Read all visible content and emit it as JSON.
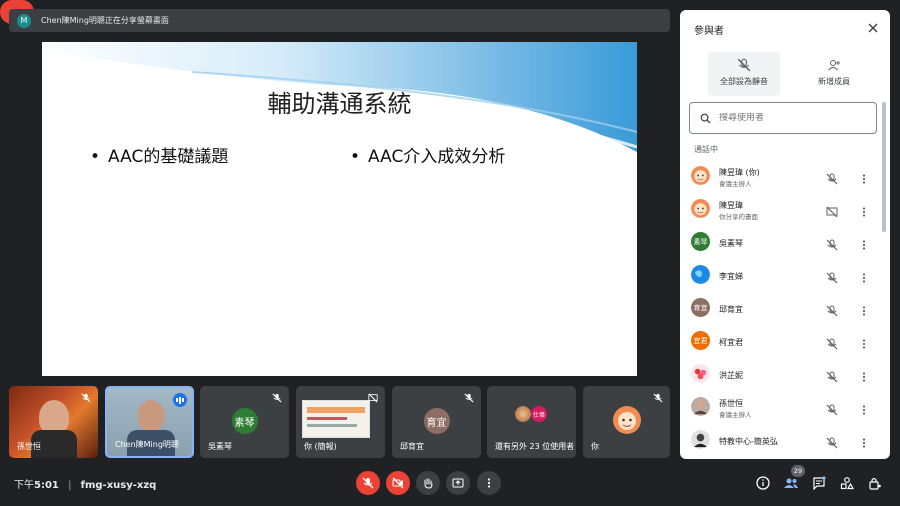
{
  "banner": {
    "avatar_letter": "M",
    "text": "Chen陳Ming明聰正在分享螢幕畫面"
  },
  "slide": {
    "title": "輔助溝通系統",
    "bullet_1": "AAC的基礎議題",
    "bullet_2": "AAC介入成效分析"
  },
  "tiles": [
    {
      "name": "孫世恒",
      "type": "video"
    },
    {
      "name": "Chen陳Ming明聰",
      "type": "video",
      "speaking": true
    },
    {
      "name": "吳素琴",
      "initials": "素琴",
      "color": "#2e7d32"
    },
    {
      "name": "你 (簡報)",
      "type": "presentation"
    },
    {
      "name": "邱育宜",
      "initials": "育宜",
      "color": "#8d6e63"
    },
    {
      "name": "還有另外 23 位使用者",
      "badge": "仕偉",
      "badge_color": "#d81b60"
    },
    {
      "name": "你",
      "type": "avatar"
    }
  ],
  "bottom": {
    "time_prefix": "下午",
    "time": "5:01",
    "separator": "|",
    "meeting_code": "fmg-xusy-xzq",
    "participant_count": "29"
  },
  "panel": {
    "title": "參與者",
    "mute_all_label": "全部設為靜音",
    "add_person_label": "新增成員",
    "search_placeholder": "搜尋使用者",
    "section_label": "通話中",
    "participants": [
      {
        "name": "陳昱瑋 (你)",
        "sub": "會議主辦人",
        "avatar": "face"
      },
      {
        "name": "陳昱瑋",
        "sub": "你分享的畫面",
        "avatar": "face",
        "present_icon": true
      },
      {
        "name": "吳素琴",
        "sub": "",
        "initials": "素琴",
        "color": "#2e7d32"
      },
      {
        "name": "李宜娣",
        "sub": "",
        "avatar": "earth"
      },
      {
        "name": "邱育宜",
        "sub": "",
        "initials": "育宜",
        "color": "#8d6e63"
      },
      {
        "name": "柯宜君",
        "sub": "",
        "initials": "宜君",
        "color": "#ef6c00"
      },
      {
        "name": "洪芷妮",
        "sub": "",
        "avatar": "flower"
      },
      {
        "name": "孫世恒",
        "sub": "會議主辦人",
        "avatar": "photo"
      },
      {
        "name": "特教中心-簡英弘",
        "sub": "",
        "avatar": "dark"
      }
    ]
  },
  "colors": {
    "red": "#ea4335",
    "panel_bg": "#ffffff",
    "bg": "#202124",
    "tile_bg": "#3c4043",
    "speaking_border": "#8ab4f8"
  }
}
